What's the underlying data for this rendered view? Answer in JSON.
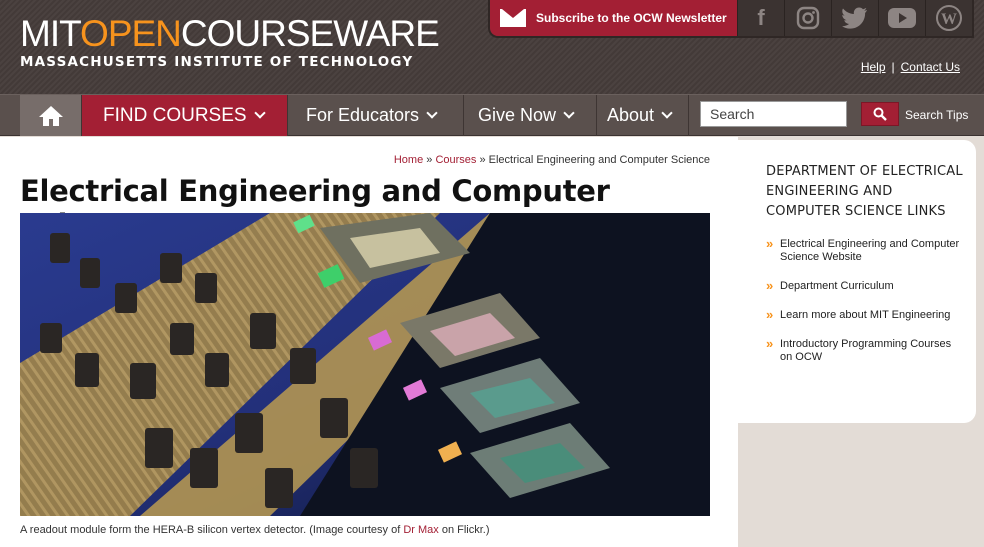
{
  "logo": {
    "part1": "MIT",
    "part2": "OPEN",
    "part3": "COURSEWARE",
    "subtitle": "MASSACHUSETTS INSTITUTE OF TECHNOLOGY"
  },
  "topbar": {
    "subscribe_label": "Subscribe to the OCW Newsletter",
    "social": [
      {
        "icon": "facebook-icon",
        "glyph": "f"
      },
      {
        "icon": "instagram-icon",
        "glyph": "◎"
      },
      {
        "icon": "twitter-icon",
        "glyph": "🐦"
      },
      {
        "icon": "youtube-icon",
        "glyph": "▶"
      },
      {
        "icon": "wordpress-icon",
        "glyph": "W"
      }
    ],
    "help": "Help",
    "separator": "|",
    "contact": "Contact Us"
  },
  "nav": {
    "find_courses": "FIND COURSES",
    "for_educators": "For Educators",
    "give_now": "Give Now",
    "about": "About",
    "search_placeholder": "Search",
    "search_tips": "Search Tips"
  },
  "breadcrumb": {
    "home": "Home",
    "sep": "»",
    "courses": "Courses",
    "current": "Electrical Engineering and Computer Science"
  },
  "page_title": "Electrical Engineering and Computer Science",
  "caption": {
    "text": "A readout module form the HERA-B silicon vertex detector. (Image courtesy of ",
    "link": "Dr Max",
    "tail": " on Flickr.)"
  },
  "sidebar": {
    "title": "DEPARTMENT OF ELECTRICAL ENGINEERING AND COMPUTER SCIENCE LINKS",
    "links": [
      "Electrical Engineering and Computer Science Website",
      "Department Curriculum",
      "Learn more about MIT Engineering",
      "Introductory Programming Courses on OCW"
    ]
  },
  "colors": {
    "accent": "#a31f34",
    "orange": "#f7931d",
    "header": "#4b4240",
    "nav": "#5a504d"
  }
}
